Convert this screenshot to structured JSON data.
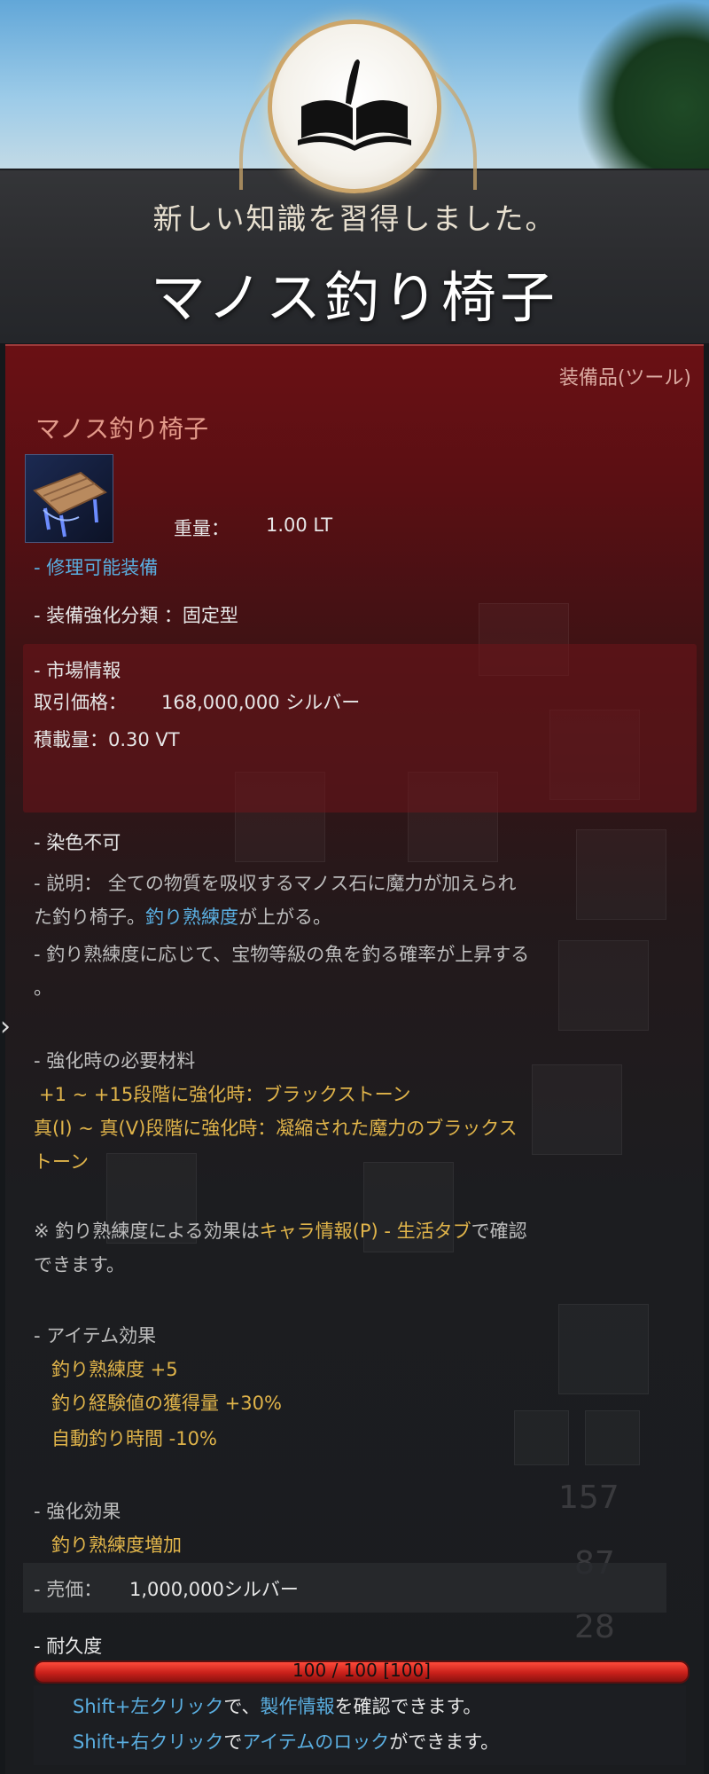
{
  "banner": {
    "subtitle": "新しい知識を習得しました。",
    "title": "マノス釣り椅子"
  },
  "item": {
    "category": "装備品(ツール)",
    "name": "マノス釣り椅子",
    "weight_label": "重量：",
    "weight_value": "1.00 LT",
    "repairable": "- 修理可能装備",
    "enhance_type": "- 装備強化分類 ：固定型",
    "market": {
      "header": "- 市場情報",
      "price_label": "取引価格：",
      "price_value": "168,000,000 シルバー",
      "load": "積載量：0.30 VT"
    },
    "dye": "- 染色不可",
    "desc_line1": "- 説明： 全ての物質を吸収するマノス石に魔力が加えられ",
    "desc_line2_a": "た釣り椅子。",
    "desc_line2_link": "釣り熟練度",
    "desc_line2_b": "が上がる。",
    "desc_line3": "- 釣り熟練度に応じて、宝物等級の魚を釣る確率が上昇する",
    "desc_line4": "。",
    "materials_header": "- 強化時の必要材料",
    "materials_line1": "+1 ~ +15段階に強化時：ブラックストーン",
    "materials_line2": "真(I) ~ 真(V)段階に強化時：凝縮された魔力のブラックス",
    "materials_line3": "トーン",
    "note_a": "※ 釣り熟練度による効果は",
    "note_link1": "キャラ情報(P) - 生活タブ",
    "note_b": "で確認",
    "note_line2": "できます。",
    "effects_header": "- アイテム効果",
    "effects": [
      "釣り熟練度 +5",
      "釣り経験値の獲得量 +30%",
      "自動釣り時間 -10%"
    ],
    "enh_effect_header": "- 強化効果",
    "enh_effect": "釣り熟練度増加",
    "sale_label": "- 売価：",
    "sale_value": "1,000,000シルバー",
    "durability_header": "- 耐久度",
    "durability_text": "100 / 100 [100]",
    "durability_fraction": 1.0
  },
  "hints": {
    "line1_key": "Shift+左クリック",
    "line1_mid": "で、",
    "line1_link": "製作情報",
    "line1_end": "を確認できます。",
    "line2_key": "Shift+右クリック",
    "line2_mid": "で",
    "line2_link": "アイテムのロック",
    "line2_end": "ができます。"
  },
  "background_numbers": [
    "157",
    "87",
    "28"
  ],
  "colors": {
    "gold": "#e0b44a",
    "link_blue": "#5aaee0",
    "durability_red": "#d42a20"
  }
}
